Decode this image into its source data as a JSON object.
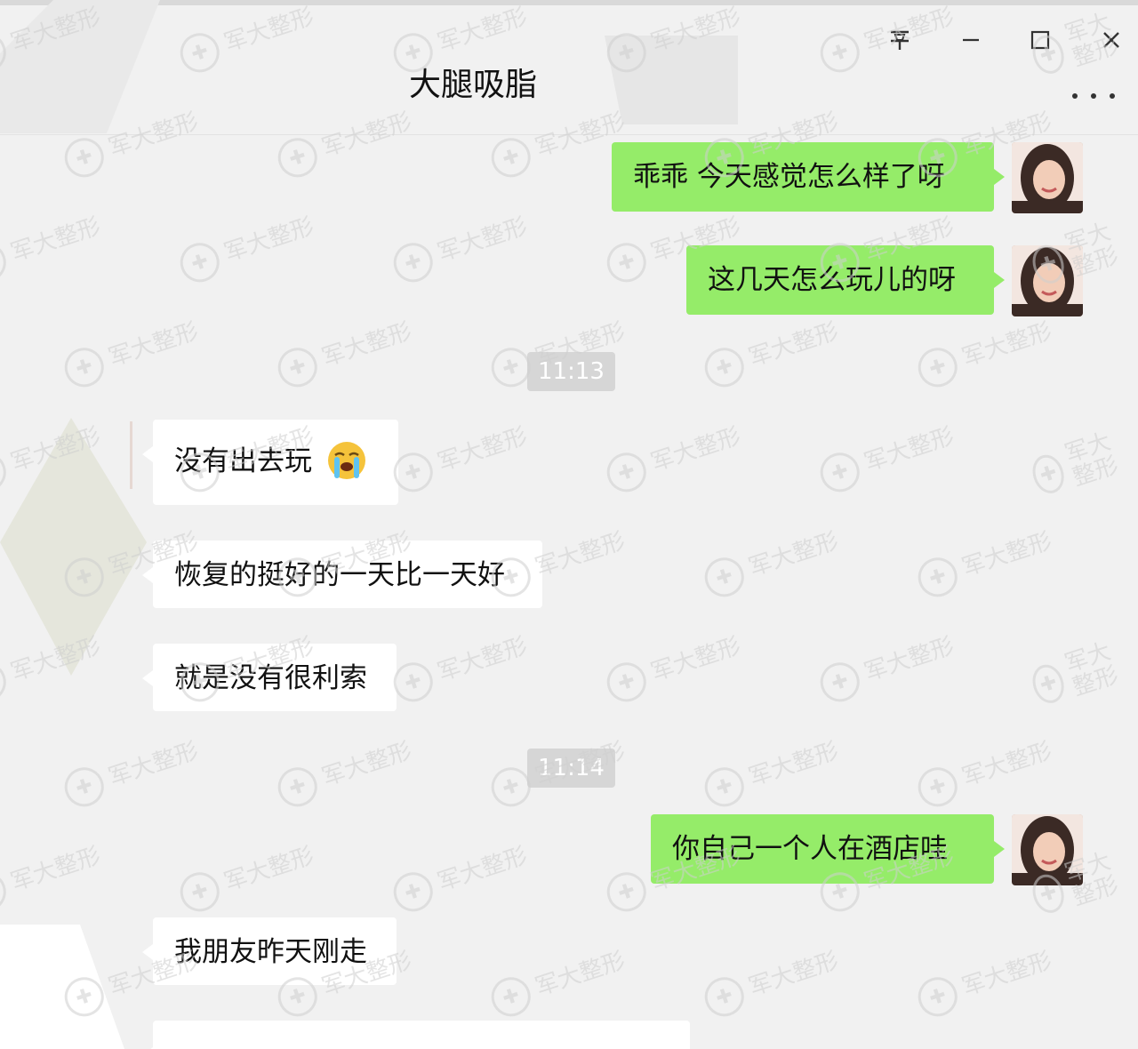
{
  "window": {
    "title": "大腿吸脂",
    "pin_glyph": "⅔",
    "minimize_glyph": "−",
    "maximize_glyph": "☐",
    "close_glyph": "✕"
  },
  "colors": {
    "outgoing_bubble": "#95ec69",
    "incoming_bubble": "#ffffff",
    "background": "#f1f1f1",
    "time_tag_bg": "#d6d6d6"
  },
  "messages": [
    {
      "direction": "out",
      "text": "乖乖 今天感觉怎么样了呀"
    },
    {
      "direction": "out",
      "text": "这几天怎么玩儿的呀"
    },
    {
      "type": "time",
      "text": "11:13"
    },
    {
      "direction": "in",
      "text": "没有出去玩",
      "emoji": "loudly-crying-face-icon"
    },
    {
      "direction": "in",
      "text": "恢复的挺好的一天比一天好"
    },
    {
      "direction": "in",
      "text": "就是没有很利索"
    },
    {
      "type": "time",
      "text": "11:14"
    },
    {
      "direction": "out",
      "text": "你自己一个人在酒店哇"
    },
    {
      "direction": "in",
      "text": "我朋友昨天刚走"
    },
    {
      "direction": "in",
      "text": ""
    }
  ],
  "watermark": {
    "text": "军大整形",
    "icon": "medical-cross-logo-icon"
  }
}
